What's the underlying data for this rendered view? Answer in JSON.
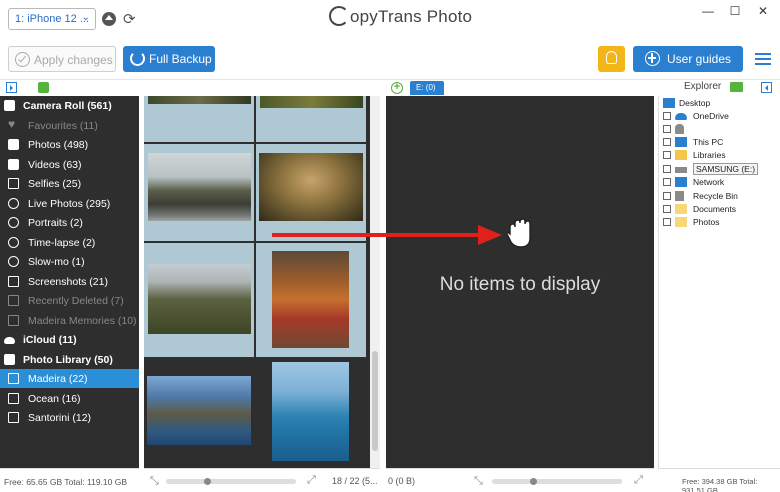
{
  "window": {
    "app_title": "CopyTrans Photo",
    "app_title_rest": "opyTrans Photo",
    "device": "1: iPhone 12 ...",
    "controls": {
      "minimize": "—",
      "maximize": "☐",
      "close": "✕"
    }
  },
  "toolbar": {
    "apply_label": "Apply changes",
    "backup_label": "Full Backup",
    "guides_label": "User guides"
  },
  "left_pane": {
    "sections": {
      "camera_roll": "Camera Roll (561)",
      "icloud": "iCloud (11)",
      "photo_library": "Photo Library (50)"
    },
    "items": [
      {
        "label": "Favourites (11)",
        "icon": "heart-icon",
        "dim": true
      },
      {
        "label": "Photos (498)",
        "icon": "camera-icon",
        "dim": false
      },
      {
        "label": "Videos (63)",
        "icon": "video-icon",
        "dim": false
      },
      {
        "label": "Selfies (25)",
        "icon": "portrait-icon",
        "dim": false
      },
      {
        "label": "Live Photos (295)",
        "icon": "live-photo-icon",
        "dim": false
      },
      {
        "label": "Portraits (2)",
        "icon": "cube-icon",
        "dim": false
      },
      {
        "label": "Time-lapse (2)",
        "icon": "timelapse-icon",
        "dim": false
      },
      {
        "label": "Slow-mo (1)",
        "icon": "slowmo-icon",
        "dim": false
      },
      {
        "label": "Screenshots (21)",
        "icon": "screenshot-icon",
        "dim": false
      },
      {
        "label": "Recently Deleted (7)",
        "icon": "trash-icon",
        "dim": true
      },
      {
        "label": "Madeira Memories (10)",
        "icon": "album-icon",
        "dim": true
      }
    ],
    "albums": [
      {
        "label": "Madeira (22)",
        "selected": true
      },
      {
        "label": "Ocean (16)",
        "selected": false
      },
      {
        "label": "Santorini (12)",
        "selected": false
      }
    ],
    "status": "Free: 65.65 GB Total: 119.10 GB",
    "grid_count": "18 / 22 (5..."
  },
  "middle_pane": {
    "drive_tab": "E: (0)",
    "empty_message": "No items to display",
    "status": "0 (0 B)"
  },
  "explorer": {
    "label": "Explorer",
    "root": "Desktop",
    "items": [
      {
        "label": "OneDrive",
        "icon": "cloud-icon"
      },
      {
        "label": "",
        "icon": "user-icon"
      },
      {
        "label": "This PC",
        "icon": "computer-icon"
      },
      {
        "label": "Libraries",
        "icon": "library-icon"
      },
      {
        "label": "SAMSUNG (E:)",
        "icon": "drive-icon",
        "highlight": true
      },
      {
        "label": "Network",
        "icon": "network-icon"
      },
      {
        "label": "Recycle Bin",
        "icon": "recycle-bin-icon"
      },
      {
        "label": "Documents",
        "icon": "folder-icon"
      },
      {
        "label": "Photos",
        "icon": "folder-icon"
      }
    ],
    "status": "Free: 394.38 GB Total: 931.51 GB"
  },
  "colors": {
    "accent_blue": "#2b7fd0",
    "selected_blue": "#2b8fd7",
    "dark_panel": "#2e2e2e",
    "bulb_yellow": "#f3b619",
    "green": "#56b33b",
    "arrow_red": "#e0201b"
  }
}
